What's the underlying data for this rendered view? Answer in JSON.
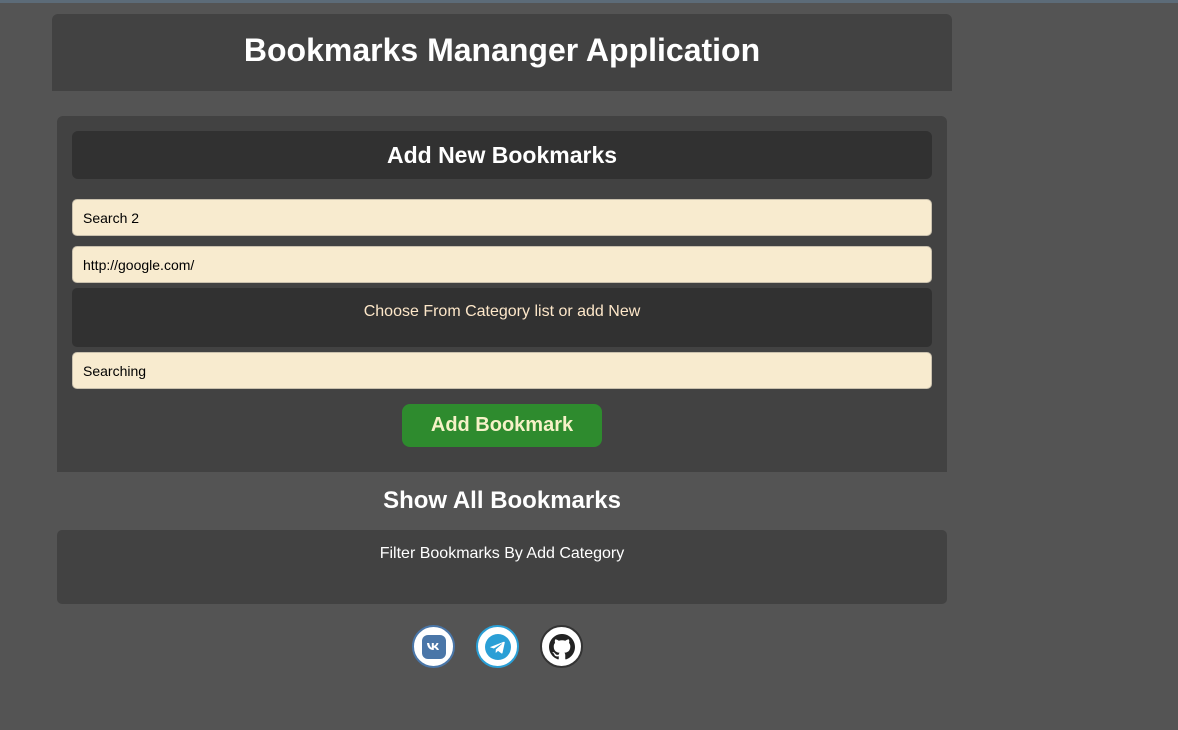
{
  "app": {
    "title": "Bookmarks Mananger Application"
  },
  "add_section": {
    "title": "Add New Bookmarks",
    "name_value": "Search 2",
    "url_value": "http://google.com/",
    "category_prompt": "Choose From Category list or add New",
    "category_value": "Searching",
    "add_button_label": "Add Bookmark"
  },
  "show_section": {
    "title": "Show All Bookmarks",
    "filter_prompt": "Filter Bookmarks By Add Category"
  },
  "socials": [
    {
      "icon": "vk-icon",
      "color": "#4a76a8"
    },
    {
      "icon": "telegram-icon",
      "color": "#2a9fd6"
    },
    {
      "icon": "github-icon",
      "color": "#222222"
    }
  ]
}
